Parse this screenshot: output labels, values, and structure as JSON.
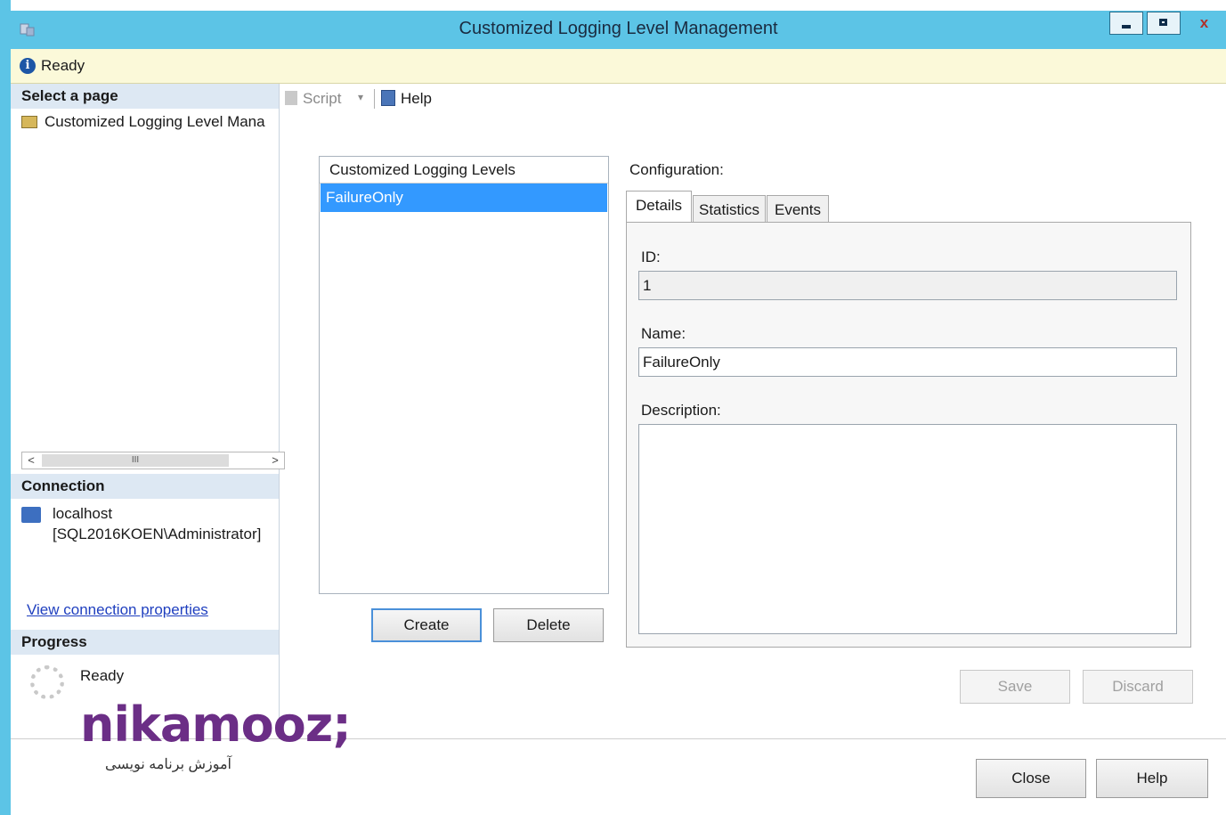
{
  "window": {
    "title": "Customized Logging Level Management",
    "close_glyph": "x"
  },
  "statusbar": {
    "text": "Ready"
  },
  "left_panel": {
    "select_page_header": "Select a page",
    "pages": [
      {
        "label": "Customized Logging Level Mana"
      }
    ],
    "scrollbar_thumb_glyph": "III",
    "connection_header": "Connection",
    "connection_server": "localhost",
    "connection_user": "[SQL2016KOEN\\Administrator]",
    "connection_link": "View connection properties",
    "progress_header": "Progress",
    "progress_status": "Ready"
  },
  "toolbar": {
    "script_label": "Script",
    "help_label": "Help"
  },
  "list": {
    "header": "Customized Logging Levels",
    "items": [
      {
        "label": "FailureOnly",
        "selected": true
      }
    ]
  },
  "list_buttons": {
    "create": "Create",
    "delete": "Delete"
  },
  "config": {
    "label": "Configuration:",
    "tabs": [
      {
        "label": "Details",
        "active": true
      },
      {
        "label": "Statistics",
        "active": false
      },
      {
        "label": "Events",
        "active": false
      }
    ],
    "id_label": "ID:",
    "id_value": "1",
    "name_label": "Name:",
    "name_value": "FailureOnly",
    "description_label": "Description:",
    "description_value": ""
  },
  "config_buttons": {
    "save": "Save",
    "discard": "Discard"
  },
  "footer_buttons": {
    "close": "Close",
    "help": "Help"
  },
  "watermark": {
    "brand": "nikamooz;",
    "tagline": "آموزش برنامه نویسی"
  },
  "colors": {
    "titlebar": "#5cc4e6",
    "selection": "#3399ff",
    "link": "#1f3fbf",
    "logo": "#6b2e86"
  }
}
